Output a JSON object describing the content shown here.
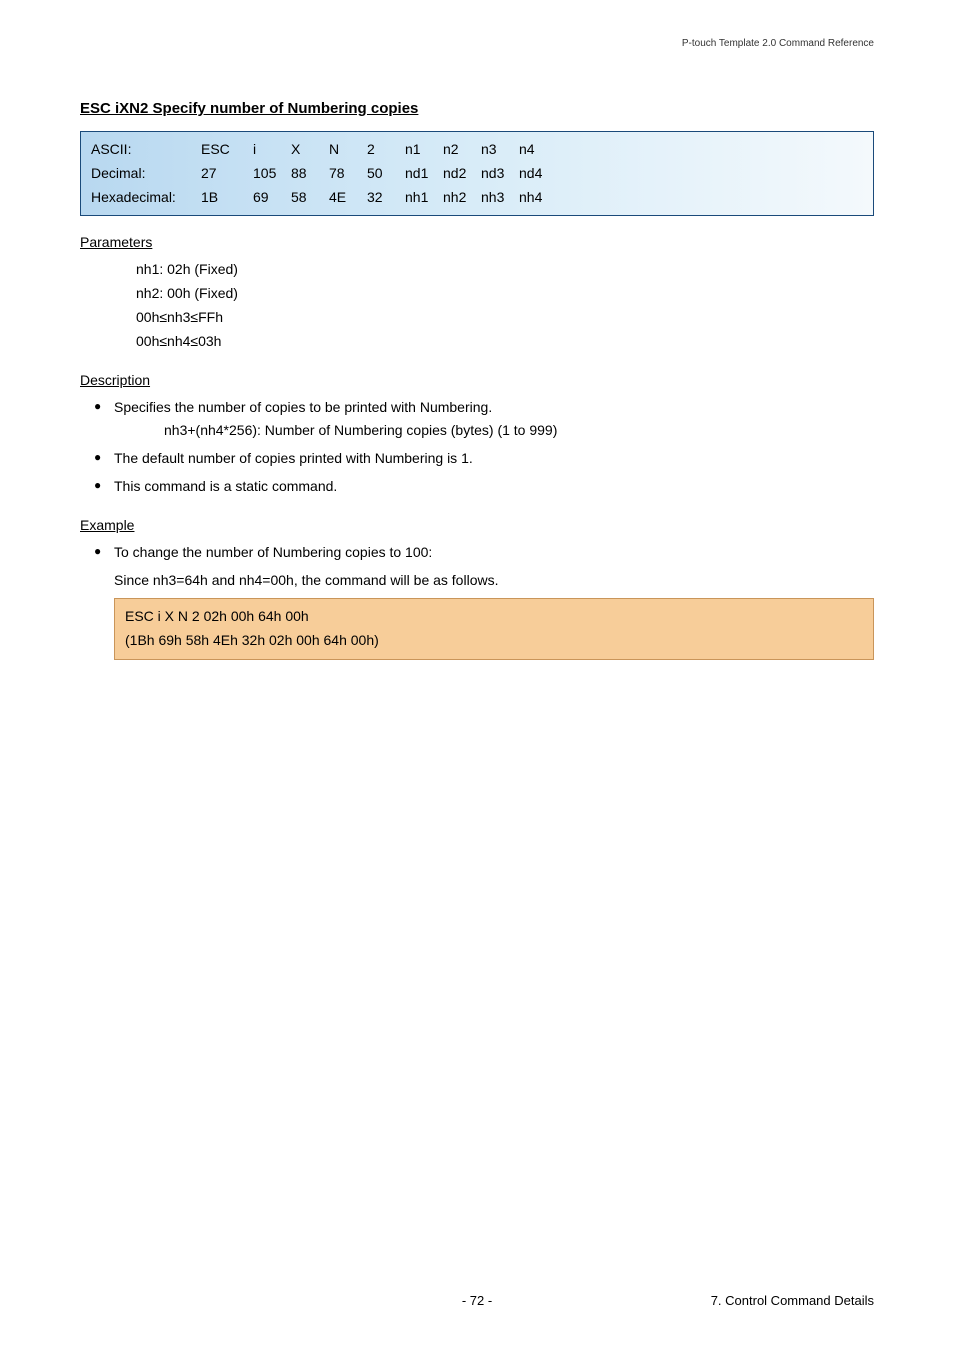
{
  "header": {
    "doc_title": "P-touch Template 2.0 Command Reference"
  },
  "section": {
    "title": "ESC iXN2   Specify number of Numbering copies"
  },
  "code_rows": {
    "ascii": {
      "label": "ASCII:",
      "c1": "ESC",
      "c2": "i",
      "c3": "X",
      "c4": "N",
      "c5": "2",
      "c6": "n1",
      "c7": "n2",
      "c8": "n3",
      "c9": "n4"
    },
    "decimal": {
      "label": "Decimal:",
      "c1": "27",
      "c2": "105",
      "c3": "88",
      "c4": "78",
      "c5": "50",
      "c6": "nd1",
      "c7": "nd2",
      "c8": "nd3",
      "c9": "nd4"
    },
    "hex": {
      "label": "Hexadecimal:",
      "c1": "1B",
      "c2": "69",
      "c3": "58",
      "c4": "4E",
      "c5": "32",
      "c6": "nh1",
      "c7": "nh2",
      "c8": "nh3",
      "c9": "nh4"
    }
  },
  "parameters": {
    "heading": "Parameters",
    "lines": {
      "l1": "nh1: 02h (Fixed)",
      "l2": "nh2: 00h (Fixed)",
      "l3": "00h≤nh3≤FFh",
      "l4": "00h≤nh4≤03h"
    }
  },
  "description": {
    "heading": "Description",
    "b1": "Specifies the number of copies to be printed with Numbering.",
    "b1_sub": "nh3+(nh4*256):   Number of Numbering copies (bytes) (1 to 999)",
    "b2": "The default number of copies printed with Numbering is 1.",
    "b3": "This command is a static command."
  },
  "example": {
    "heading": "Example",
    "b1": "To change the number of Numbering copies to 100:",
    "cont": "Since nh3=64h and nh4=00h, the command will be as follows.",
    "box_l1": "ESC i X N 2 02h 00h 64h 00h",
    "box_l2": "(1Bh 69h 58h 4Eh 32h 02h 00h 64h 00h)"
  },
  "footer": {
    "page": "- 72 -",
    "section_label": "7. Control Command Details"
  }
}
